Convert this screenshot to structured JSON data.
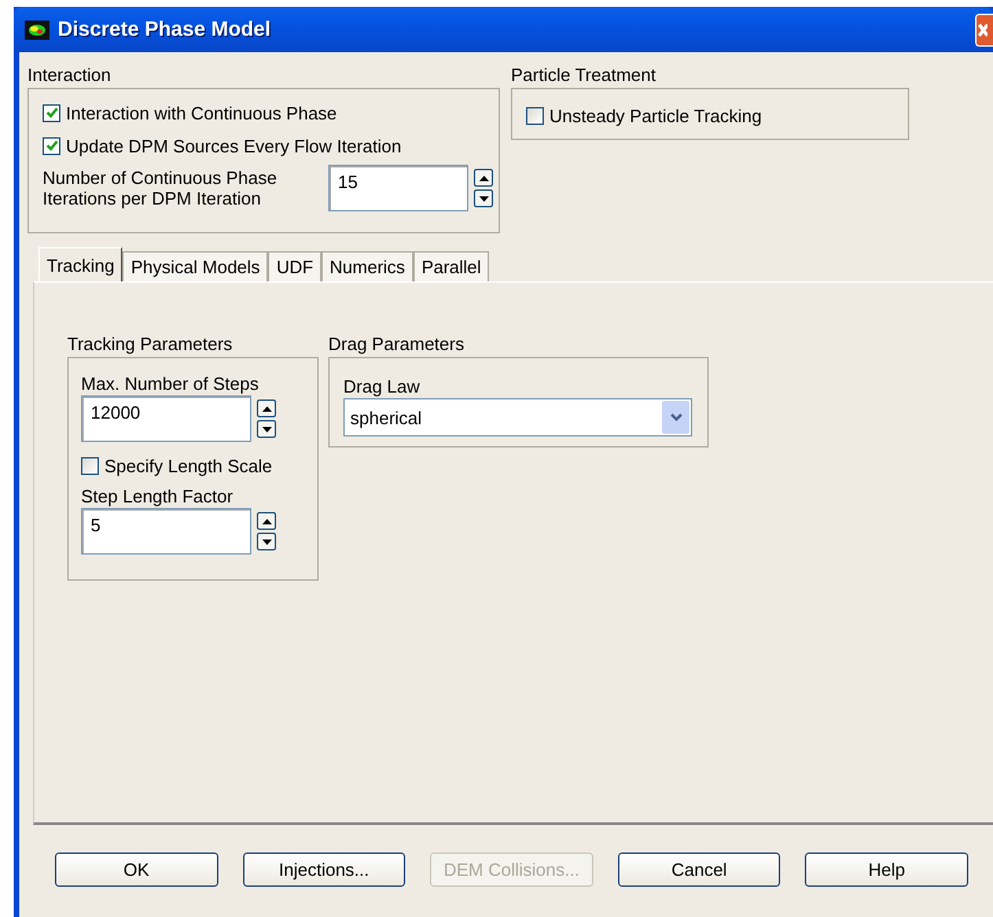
{
  "window": {
    "title": "Discrete Phase Model"
  },
  "interaction": {
    "label": "Interaction",
    "options": [
      {
        "label": "Interaction with Continuous Phase",
        "checked": true
      },
      {
        "label": "Update DPM Sources Every Flow Iteration",
        "checked": true
      }
    ],
    "iterations": {
      "label": "Number of Continuous Phase Iterations per DPM Iteration",
      "value": "15"
    }
  },
  "particle_treatment": {
    "label": "Particle Treatment",
    "options": [
      {
        "label": "Unsteady Particle Tracking",
        "checked": false
      }
    ]
  },
  "tabs": [
    {
      "label": "Tracking",
      "selected": true
    },
    {
      "label": "Physical Models",
      "selected": false
    },
    {
      "label": "UDF",
      "selected": false
    },
    {
      "label": "Numerics",
      "selected": false
    },
    {
      "label": "Parallel",
      "selected": false
    }
  ],
  "tracking_parameters": {
    "label": "Tracking Parameters",
    "max_steps": {
      "label": "Max. Number of Steps",
      "value": "12000"
    },
    "length_scale": {
      "label": "Specify Length Scale",
      "checked": false
    },
    "step_length_factor": {
      "label": "Step Length Factor",
      "value": "5"
    }
  },
  "drag_parameters": {
    "label": "Drag Parameters",
    "drag_law": {
      "label": "Drag Law",
      "value": "spherical"
    }
  },
  "buttons": [
    {
      "label": "OK",
      "disabled": false
    },
    {
      "label": "Injections...",
      "disabled": false
    },
    {
      "label": "DEM Collisions...",
      "disabled": true
    },
    {
      "label": "Cancel",
      "disabled": false
    },
    {
      "label": "Help",
      "disabled": false
    }
  ]
}
